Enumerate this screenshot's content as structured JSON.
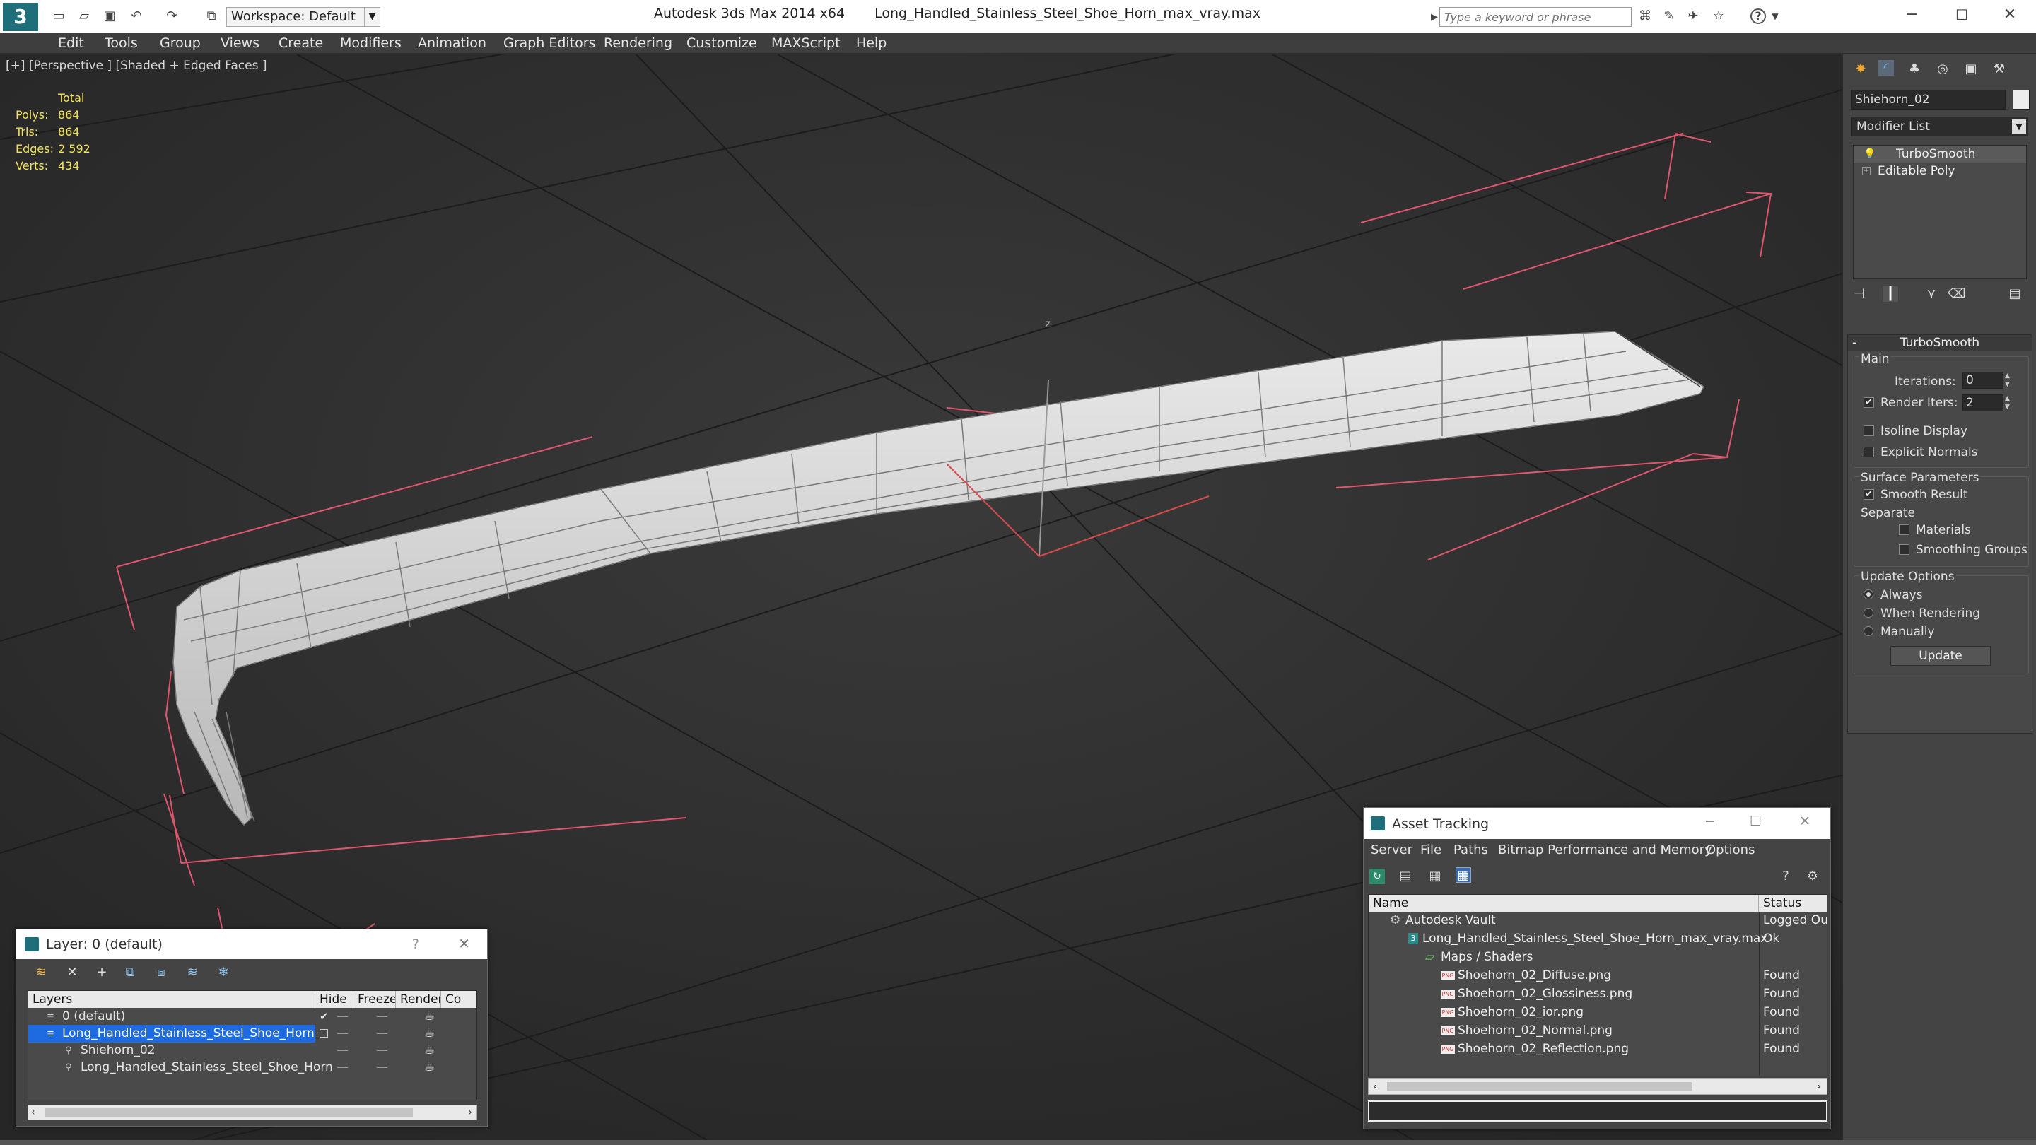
{
  "titlebar": {
    "workspace": "Workspace: Default",
    "app_title": "Autodesk 3ds Max  2014 x64",
    "file_title": "Long_Handled_Stainless_Steel_Shoe_Horn_max_vray.max",
    "search_placeholder": "Type a keyword or phrase"
  },
  "menu": [
    "Edit",
    "Tools",
    "Group",
    "Views",
    "Create",
    "Modifiers",
    "Animation",
    "Graph Editors",
    "Rendering",
    "Customize",
    "MAXScript",
    "Help"
  ],
  "viewport": {
    "label": "[+] [Perspective ] [Shaded + Edged Faces ]",
    "stats": {
      "header": "Total",
      "rows": [
        {
          "label": "Polys:",
          "value": "864"
        },
        {
          "label": "Tris:",
          "value": "864"
        },
        {
          "label": "Edges:",
          "value": "2 592"
        },
        {
          "label": "Verts:",
          "value": "434"
        }
      ]
    },
    "axis_label": "z"
  },
  "command_panel": {
    "object_name": "Shiehorn_02",
    "modifier_list": "Modifier List",
    "stack": [
      "TurboSmooth",
      "Editable Poly"
    ],
    "rollout_title": "TurboSmooth",
    "main_label": "Main",
    "iterations_label": "Iterations:",
    "iterations_value": "0",
    "render_iters_label": "Render Iters:",
    "render_iters_value": "2",
    "render_iters_checked": true,
    "isoline_label": "Isoline Display",
    "explicit_normals_label": "Explicit Normals",
    "surface_params_label": "Surface Parameters",
    "smooth_result_label": "Smooth Result",
    "separate_label": "Separate",
    "materials_label": "Materials",
    "smoothing_groups_label": "Smoothing Groups",
    "update_options_label": "Update Options",
    "always_label": "Always",
    "when_rendering_label": "When Rendering",
    "manually_label": "Manually",
    "update_button": "Update"
  },
  "layer_window": {
    "title": "Layer: 0 (default)",
    "help": "?",
    "columns": [
      "Layers",
      "Hide",
      "Freeze",
      "Render",
      "Co"
    ],
    "rows": [
      {
        "name": "0 (default)",
        "indent": 0,
        "selected": false
      },
      {
        "name": "Long_Handled_Stainless_Steel_Shoe_Horn",
        "indent": 0,
        "selected": true
      },
      {
        "name": "Shiehorn_02",
        "indent": 1,
        "selected": false
      },
      {
        "name": "Long_Handled_Stainless_Steel_Shoe_Horn",
        "indent": 1,
        "selected": false
      }
    ]
  },
  "asset_window": {
    "title": "Asset Tracking",
    "menus": [
      "Server",
      "File",
      "Paths",
      "Bitmap Performance and Memory",
      "Options"
    ],
    "columns": [
      "Name",
      "Status"
    ],
    "rows": [
      {
        "name": "Autodesk Vault",
        "status": "Logged Ou",
        "indent": 0
      },
      {
        "name": "Long_Handled_Stainless_Steel_Shoe_Horn_max_vray.max",
        "status": "Ok",
        "indent": 1
      },
      {
        "name": "Maps / Shaders",
        "status": "",
        "indent": 2
      },
      {
        "name": "Shoehorn_02_Diffuse.png",
        "status": "Found",
        "indent": 3
      },
      {
        "name": "Shoehorn_02_Glossiness.png",
        "status": "Found",
        "indent": 3
      },
      {
        "name": "Shoehorn_02_ior.png",
        "status": "Found",
        "indent": 3
      },
      {
        "name": "Shoehorn_02_Normal.png",
        "status": "Found",
        "indent": 3
      },
      {
        "name": "Shoehorn_02_Reflection.png",
        "status": "Found",
        "indent": 3
      }
    ]
  }
}
